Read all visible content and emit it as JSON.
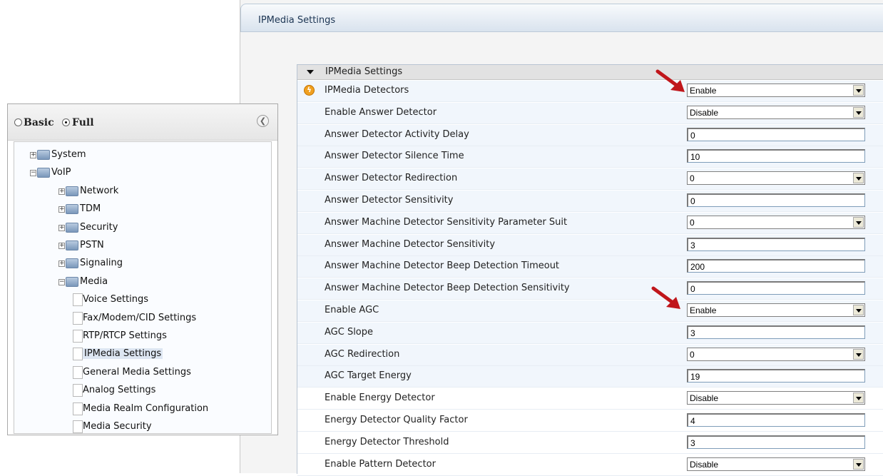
{
  "main": {
    "title": "IPMedia Settings",
    "section_title": "IPMedia Settings",
    "rows": [
      {
        "label": "IPMedia Detectors",
        "type": "select",
        "value": "Enable",
        "icon": "lightning-icon"
      },
      {
        "label": "Enable Answer Detector",
        "type": "select",
        "value": "Disable"
      },
      {
        "label": "Answer Detector Activity Delay",
        "type": "text",
        "value": "0"
      },
      {
        "label": "Answer Detector Silence Time",
        "type": "text",
        "value": "10"
      },
      {
        "label": "Answer Detector Redirection",
        "type": "select",
        "value": "0"
      },
      {
        "label": "Answer Detector Sensitivity",
        "type": "text",
        "value": "0"
      },
      {
        "label": "Answer Machine Detector Sensitivity Parameter Suit",
        "type": "select",
        "value": "0"
      },
      {
        "label": "Answer Machine Detector Sensitivity",
        "type": "text",
        "value": "3"
      },
      {
        "label": "Answer Machine Detector Beep Detection Timeout",
        "type": "text",
        "value": "200"
      },
      {
        "label": "Answer Machine Detector Beep Detection Sensitivity",
        "type": "text",
        "value": "0"
      },
      {
        "label": "Enable AGC",
        "type": "select",
        "value": "Enable"
      },
      {
        "label": "AGC Slope",
        "type": "text",
        "value": "3"
      },
      {
        "label": "AGC Redirection",
        "type": "select",
        "value": "0"
      },
      {
        "label": "AGC Target Energy",
        "type": "text",
        "value": "19"
      },
      {
        "label": "Enable Energy Detector",
        "type": "select",
        "value": "Disable"
      },
      {
        "label": "Energy Detector Quality Factor",
        "type": "text",
        "value": "4"
      },
      {
        "label": "Energy Detector Threshold",
        "type": "text",
        "value": "3"
      },
      {
        "label": "Enable Pattern Detector",
        "type": "select",
        "value": "Disable"
      }
    ]
  },
  "nav": {
    "mode_basic": "Basic",
    "mode_full": "Full",
    "selected_mode": "Full",
    "tree": [
      {
        "label": "System",
        "kind": "folder",
        "expanded": false
      },
      {
        "label": "VoIP",
        "kind": "folder",
        "expanded": true
      },
      {
        "label": "Network",
        "kind": "folder",
        "expanded": false
      },
      {
        "label": "TDM",
        "kind": "folder",
        "expanded": false
      },
      {
        "label": "Security",
        "kind": "folder",
        "expanded": false
      },
      {
        "label": "PSTN",
        "kind": "folder",
        "expanded": false
      },
      {
        "label": "Signaling",
        "kind": "folder",
        "expanded": false
      },
      {
        "label": "Media",
        "kind": "folder",
        "expanded": true
      },
      {
        "label": "Voice Settings",
        "kind": "page"
      },
      {
        "label": "Fax/Modem/CID Settings",
        "kind": "page"
      },
      {
        "label": "RTP/RTCP Settings",
        "kind": "page"
      },
      {
        "label": "IPMedia Settings",
        "kind": "page",
        "selected": true
      },
      {
        "label": "General Media Settings",
        "kind": "page"
      },
      {
        "label": "Analog Settings",
        "kind": "page"
      },
      {
        "label": "Media Realm Configuration",
        "kind": "page"
      },
      {
        "label": "Media Security",
        "kind": "page"
      }
    ]
  },
  "colors": {
    "annotation_arrow": "#c0161b",
    "lightning_icon": "#f0a020"
  }
}
